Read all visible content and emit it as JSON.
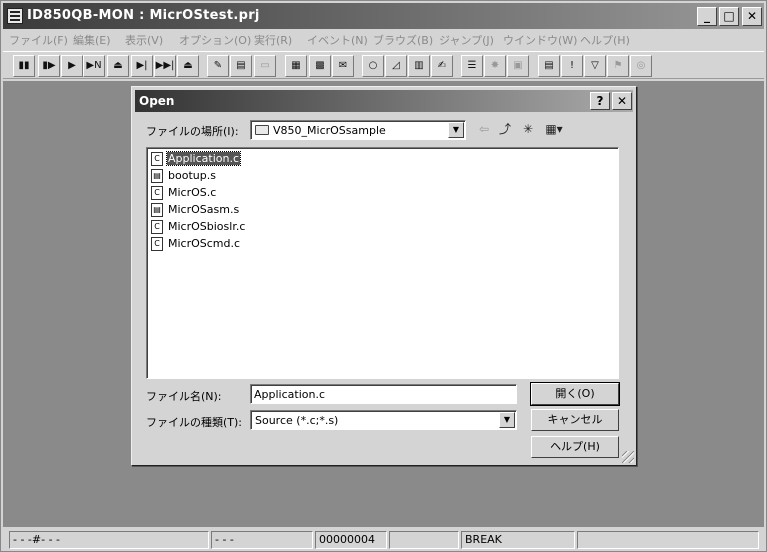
{
  "window": {
    "title": "ID850QB-MON : MicrOStest.prj",
    "minimize": "_",
    "maximize": "□",
    "close": "✕"
  },
  "menu": [
    "ファイル(F)",
    "編集(E)",
    "表示(V)",
    "オプション(O)",
    "実行(R)",
    "イベント(N)",
    "ブラウズ(B)",
    "ジャンプ(J)",
    "ウインドウ(W)",
    "ヘルプ(H)"
  ],
  "toolbar": {
    "buttons": [
      {
        "icon": "stop-icon",
        "glyph": "▮▮"
      },
      {
        "icon": "restart-icon",
        "glyph": "▮▶"
      },
      {
        "icon": "go-icon",
        "glyph": "▶"
      },
      {
        "icon": "go-n-icon",
        "glyph": "▶N"
      },
      {
        "icon": "return-icon",
        "glyph": "⏏"
      },
      {
        "icon": "step-in-icon",
        "glyph": "▶|"
      },
      {
        "icon": "next-over-icon",
        "glyph": "▶▶|"
      },
      {
        "icon": "eject-icon",
        "glyph": "⏏"
      },
      {
        "icon": "source-icon",
        "glyph": "✎"
      },
      {
        "icon": "assemble-icon",
        "glyph": "▤"
      },
      {
        "icon": "blank-icon",
        "glyph": "▭"
      },
      {
        "icon": "register-icon",
        "glyph": "▦"
      },
      {
        "icon": "memory-icon",
        "glyph": "▩"
      },
      {
        "icon": "io-icon",
        "glyph": "✉"
      },
      {
        "icon": "watch-icon",
        "glyph": "○"
      },
      {
        "icon": "local-icon",
        "glyph": "◿"
      },
      {
        "icon": "stack-icon",
        "glyph": "▥"
      },
      {
        "icon": "trace-icon",
        "glyph": "✍"
      },
      {
        "icon": "timer-icon",
        "glyph": "☰"
      },
      {
        "icon": "coverage-icon",
        "glyph": "✸"
      },
      {
        "icon": "snap-icon",
        "glyph": "▣"
      },
      {
        "icon": "event-icon",
        "glyph": "▤"
      },
      {
        "icon": "break-icon",
        "glyph": "!"
      },
      {
        "icon": "filter-icon",
        "glyph": "▽"
      },
      {
        "icon": "trace-event-icon",
        "glyph": "⚑"
      },
      {
        "icon": "stopwatch-icon",
        "glyph": "◎"
      }
    ]
  },
  "dialog": {
    "title": "Open",
    "help_btn": "?",
    "close_btn": "✕",
    "location_label": "ファイルの場所(I):",
    "location_value": "V850_MicrOSsample",
    "files": [
      {
        "name": "Application.c",
        "type": "C",
        "selected": true
      },
      {
        "name": "bootup.s",
        "type": "S",
        "selected": false
      },
      {
        "name": "MicrOS.c",
        "type": "C",
        "selected": false
      },
      {
        "name": "MicrOSasm.s",
        "type": "S",
        "selected": false
      },
      {
        "name": "MicrOSbioslr.c",
        "type": "C",
        "selected": false
      },
      {
        "name": "MicrOScmd.c",
        "type": "C",
        "selected": false
      }
    ],
    "filename_label": "ファイル名(N):",
    "filename_value": "Application.c",
    "filetype_label": "ファイルの種類(T):",
    "filetype_value": "Source (*.c;*.s)",
    "open_btn": "開く(O)",
    "cancel_btn": "キャンセル",
    "help_text_btn": "ヘルプ(H)"
  },
  "status": {
    "cell1": "- - -#- - -",
    "cell2": "- - -",
    "cell3": "00000004",
    "cell4": "BREAK",
    "cell5": "",
    "cell6": ""
  }
}
